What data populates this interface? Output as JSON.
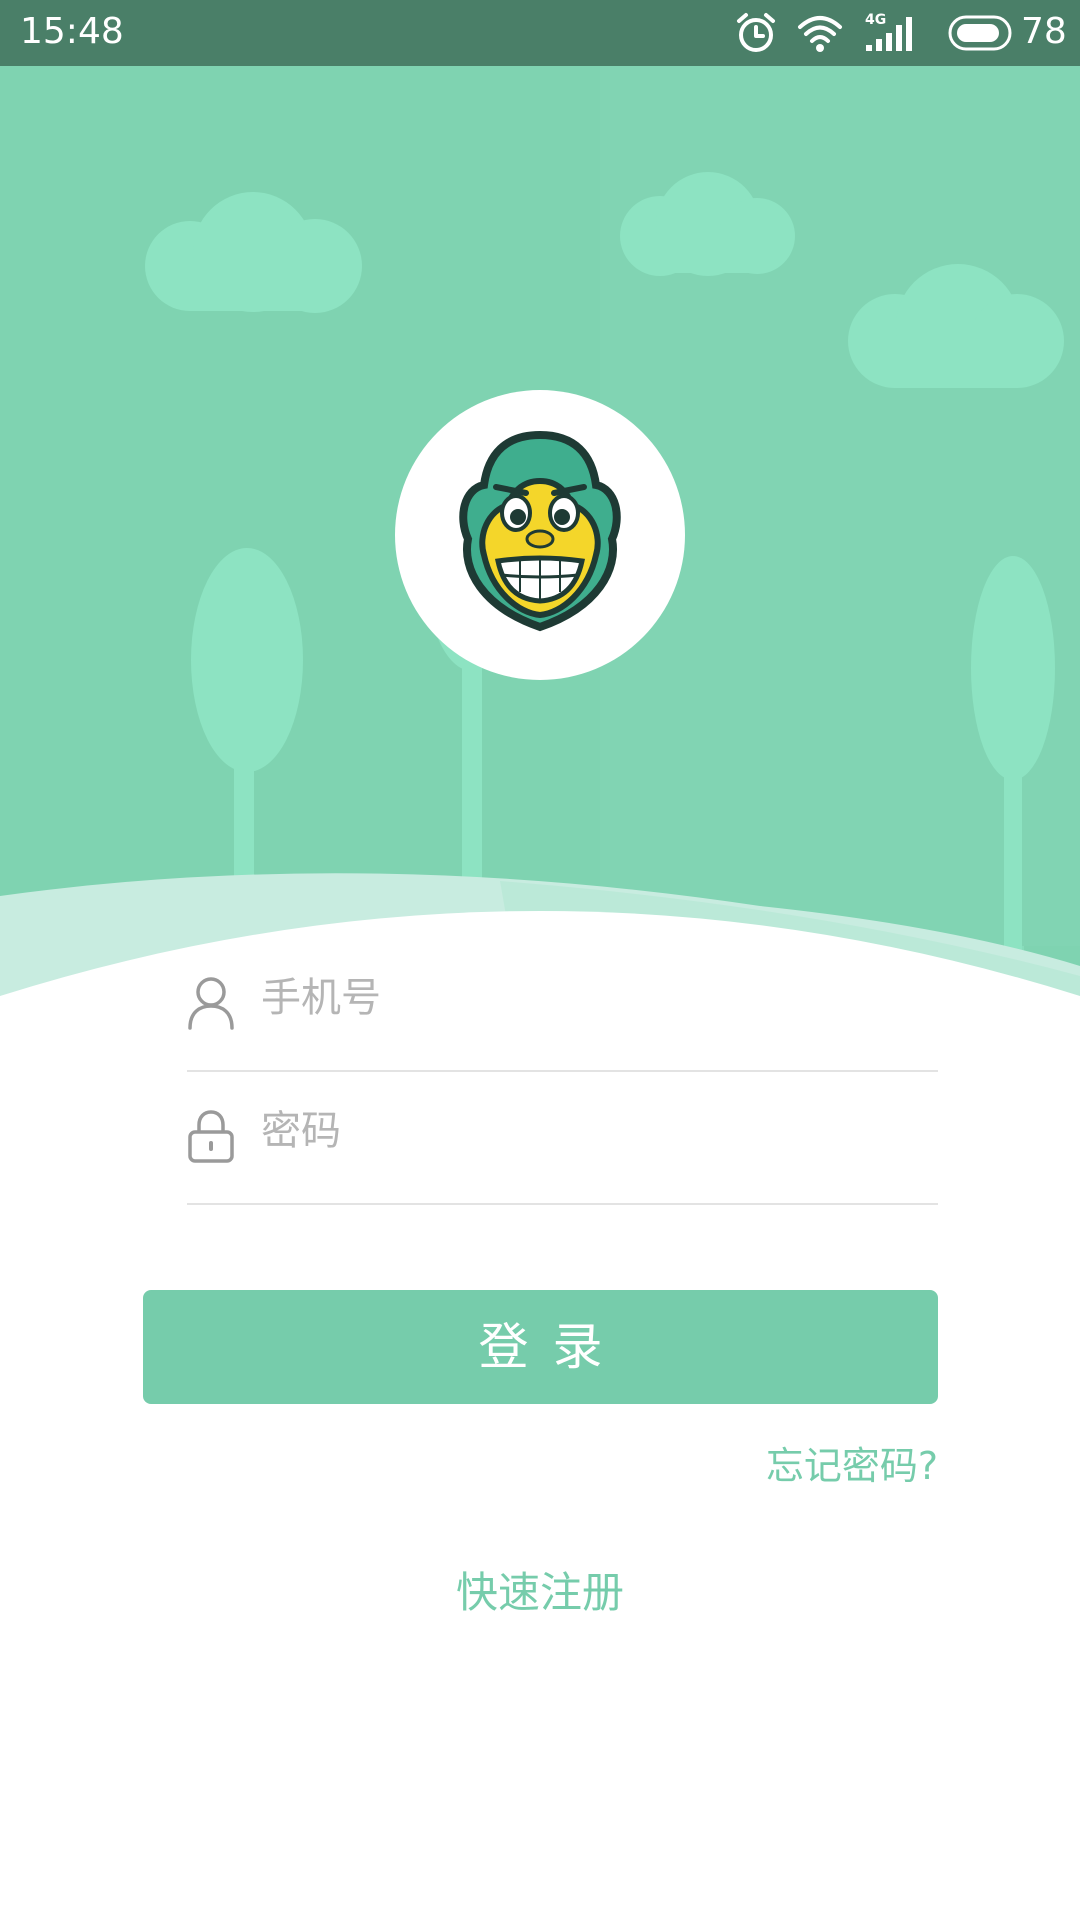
{
  "status_bar": {
    "time": "15:48",
    "network": "4G",
    "battery": "78",
    "icons": [
      "alarm-icon",
      "wifi-icon",
      "signal-icon",
      "battery-icon"
    ]
  },
  "brand": {
    "logo": "monkey-face-logo",
    "theme_color": "#76ccab",
    "background_color": "#7fd3b1",
    "status_bar_color": "#4a7f68"
  },
  "form": {
    "phone_placeholder": "手机号",
    "phone_value": "",
    "password_placeholder": "密码",
    "password_value": "",
    "phone_icon": "user-icon",
    "password_icon": "lock-icon"
  },
  "actions": {
    "login_label": "登录",
    "forgot_password_label": "忘记密码?",
    "register_label": "快速注册"
  }
}
